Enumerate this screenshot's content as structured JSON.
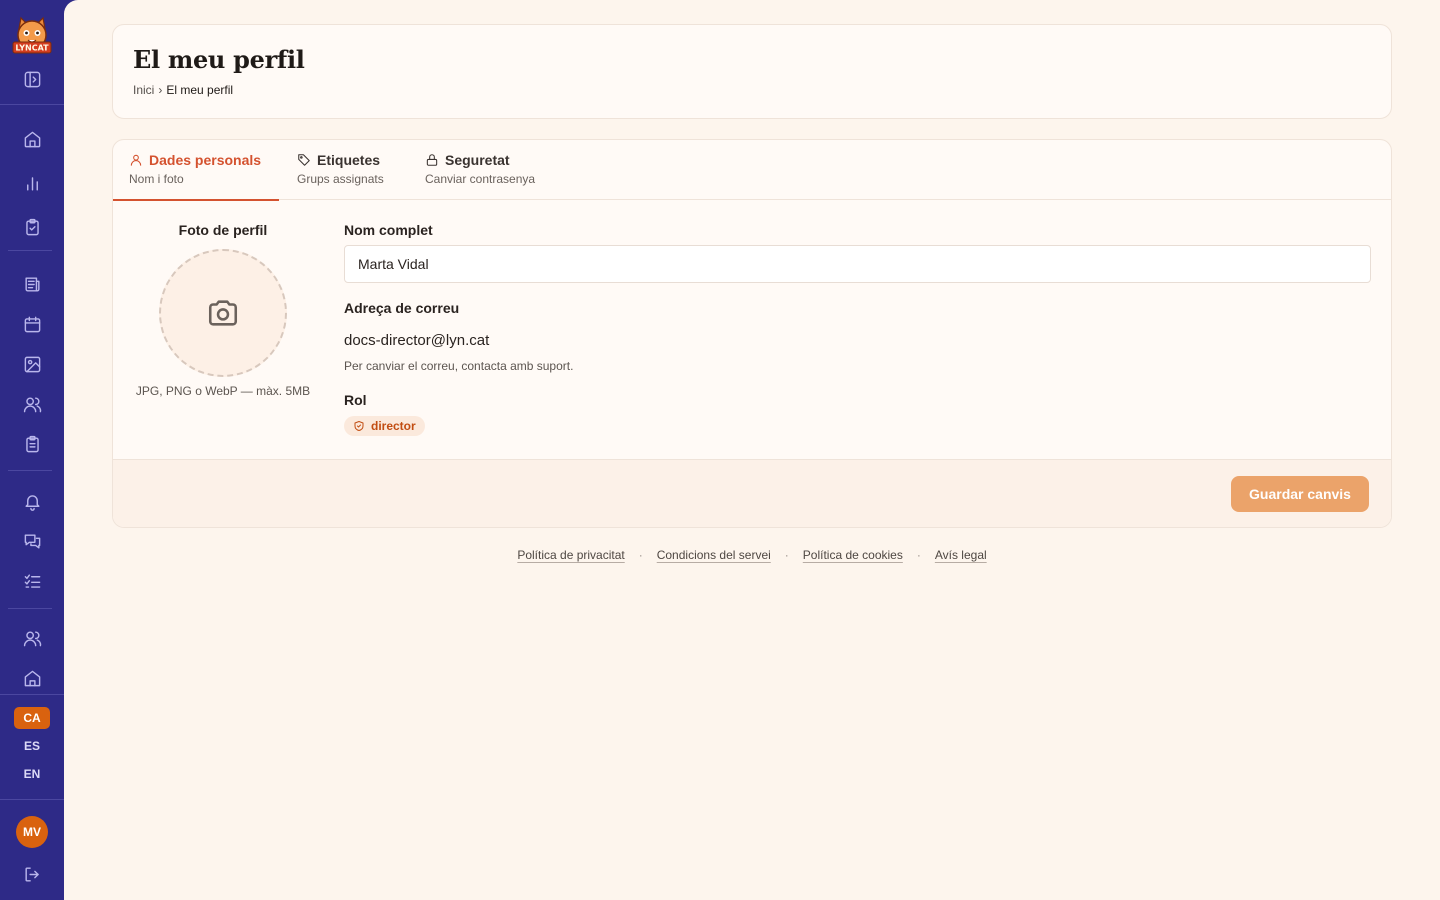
{
  "brand": {
    "logo_text": "LYNCAT"
  },
  "header": {
    "title": "El meu perfil",
    "breadcrumb": {
      "home": "Inici",
      "separator": "›",
      "current": "El meu perfil"
    }
  },
  "tabs": [
    {
      "label": "Dades personals",
      "sub": "Nom i foto",
      "icon": "user-icon",
      "active": true
    },
    {
      "label": "Etiquetes",
      "sub": "Grups assignats",
      "icon": "tag-icon",
      "active": false
    },
    {
      "label": "Seguretat",
      "sub": "Canviar contrasenya",
      "icon": "lock-icon",
      "active": false
    }
  ],
  "profile": {
    "photo_label": "Foto de perfil",
    "photo_hint": "JPG, PNG o WebP — màx. 5MB",
    "name_label": "Nom complet",
    "name_value": "Marta Vidal",
    "email_label": "Adreça de correu",
    "email_value": "docs-director@lyn.cat",
    "email_hint": "Per canviar el correu, contacta amb suport.",
    "role_label": "Rol",
    "role_value": "director"
  },
  "actions": {
    "save_label": "Guardar canvis"
  },
  "footer": {
    "links": [
      "Política de privacitat",
      "Condicions del servei",
      "Política de cookies",
      "Avís legal"
    ],
    "separator": "·"
  },
  "languages": [
    {
      "code": "CA",
      "active": true
    },
    {
      "code": "ES",
      "active": false
    },
    {
      "code": "EN",
      "active": false
    }
  ],
  "user": {
    "initials": "MV"
  },
  "colors": {
    "sidebar": "#2e2a87",
    "accent": "#d4522f",
    "language_active": "#d9620f",
    "save_button": "#eba36a",
    "page_background": "#fdf5ed"
  }
}
